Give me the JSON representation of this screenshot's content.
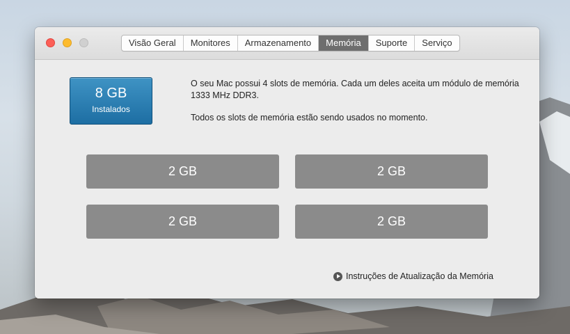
{
  "window": {
    "tabs": [
      {
        "label": "Visão Geral"
      },
      {
        "label": "Monitores"
      },
      {
        "label": "Armazenamento"
      },
      {
        "label": "Memória"
      },
      {
        "label": "Suporte"
      },
      {
        "label": "Serviço"
      }
    ],
    "active_tab": "Memória"
  },
  "memory": {
    "installed": {
      "size": "8 GB",
      "label": "Instalados"
    },
    "description": "O seu Mac possui 4 slots de memória. Cada um deles aceita um módulo de memória 1333 MHz DDR3.",
    "status": "Todos os slots de memória estão sendo usados no momento.",
    "slots": [
      {
        "size": "2 GB"
      },
      {
        "size": "2 GB"
      },
      {
        "size": "2 GB"
      },
      {
        "size": "2 GB"
      }
    ],
    "upgrade_link": "Instruções de Atualização da Memória"
  },
  "colors": {
    "installed_badge": "#2a7fb5",
    "slot_fill": "#8b8b8b",
    "active_tab": "#6e6e6e",
    "close": "#fc5f57",
    "minimize": "#fdbb2e",
    "zoom_disabled": "#d0d0d0"
  }
}
